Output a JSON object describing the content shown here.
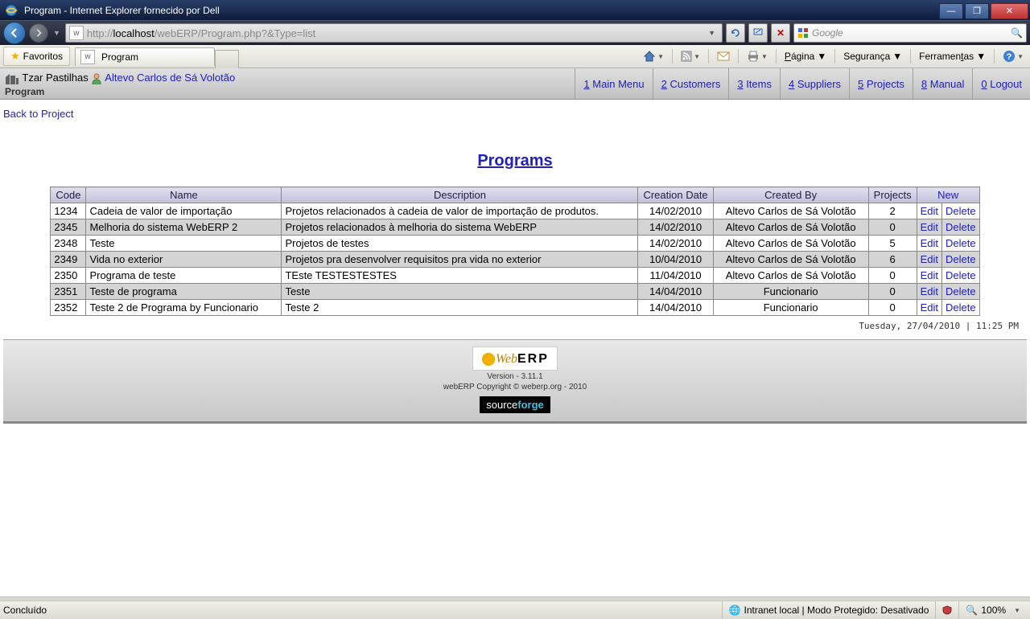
{
  "window": {
    "title": "Program - Internet Explorer fornecido por Dell"
  },
  "address": {
    "prefix": "http://",
    "host": "localhost",
    "path": "/webERP/Program.php?&Type=list"
  },
  "search": {
    "placeholder": "Google"
  },
  "ietoolbar": {
    "favorites": "Favoritos",
    "tab_title": "Program",
    "page": "Página",
    "security": "Segurança",
    "tools": "Ferramentas"
  },
  "erp": {
    "company": "Tzar Pastilhas",
    "user": "Altevo Carlos de Sá Volotão",
    "subtitle": "Program",
    "nav": {
      "main": {
        "n": "1",
        "t": "Main Menu"
      },
      "customers": {
        "n": "2",
        "t": "Customers"
      },
      "items": {
        "n": "3",
        "t": "Items"
      },
      "suppliers": {
        "n": "4",
        "t": "Suppliers"
      },
      "projects": {
        "n": "5",
        "t": "Projects"
      },
      "manual": {
        "n": "8",
        "t": "Manual"
      },
      "logout": {
        "n": "0",
        "t": "Logout"
      }
    }
  },
  "page": {
    "back": "Back to Project",
    "title": "Programs",
    "headers": {
      "code": "Code",
      "name": "Name",
      "desc": "Description",
      "date": "Creation Date",
      "by": "Created By",
      "projects": "Projects",
      "new": "New"
    },
    "actions": {
      "edit": "Edit",
      "delete": "Delete"
    },
    "rows": [
      {
        "code": "1234",
        "name": "Cadeia de valor de importação",
        "desc": "Projetos relacionados à cadeia de valor de importação de produtos.",
        "date": "14/02/2010",
        "by": "Altevo Carlos de Sá Volotão",
        "projects": "2"
      },
      {
        "code": "2345",
        "name": "Melhoria do sistema WebERP 2",
        "desc": "Projetos relacionados à melhoria do sistema WebERP",
        "date": "14/02/2010",
        "by": "Altevo Carlos de Sá Volotão",
        "projects": "0"
      },
      {
        "code": "2348",
        "name": "Teste",
        "desc": "Projetos de testes",
        "date": "14/02/2010",
        "by": "Altevo Carlos de Sá Volotão",
        "projects": "5"
      },
      {
        "code": "2349",
        "name": "Vida no exterior",
        "desc": "Projetos pra desenvolver requisitos pra vida no exterior",
        "date": "10/04/2010",
        "by": "Altevo Carlos de Sá Volotão",
        "projects": "6"
      },
      {
        "code": "2350",
        "name": "Programa de teste",
        "desc": "TEste TESTESTESTES",
        "date": "11/04/2010",
        "by": "Altevo Carlos de Sá Volotão",
        "projects": "0"
      },
      {
        "code": "2351",
        "name": "Teste de programa",
        "desc": "Teste",
        "date": "14/04/2010",
        "by": "Funcionario",
        "projects": "0"
      },
      {
        "code": "2352",
        "name": "Teste 2 de Programa by Funcionario",
        "desc": "Teste 2",
        "date": "14/04/2010",
        "by": "Funcionario",
        "projects": "0"
      }
    ],
    "timestamp": "Tuesday, 27/04/2010 | 11:25 PM"
  },
  "footer": {
    "version": "Version - 3.11.1",
    "copyright": "webERP Copyright © weberp.org - 2010"
  },
  "status": {
    "done": "Concluído",
    "zone": "Intranet local | Modo Protegido: Desativado",
    "zoom": "100%"
  }
}
